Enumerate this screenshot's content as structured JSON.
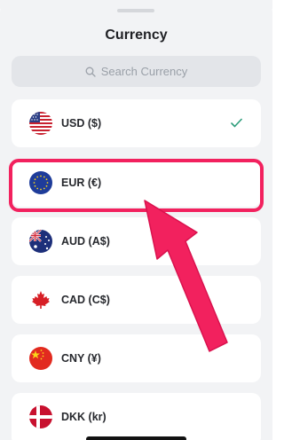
{
  "sheet": {
    "title": "Currency"
  },
  "search": {
    "placeholder": "Search Currency"
  },
  "currencies": [
    {
      "label": "USD ($)",
      "flag": "us-flag-icon",
      "selected": true
    },
    {
      "label": "EUR (€)",
      "flag": "eu-flag-icon",
      "selected": false
    },
    {
      "label": "AUD (A$)",
      "flag": "au-flag-icon",
      "selected": false
    },
    {
      "label": "CAD (C$)",
      "flag": "ca-flag-icon",
      "selected": false
    },
    {
      "label": "CNY (¥)",
      "flag": "cn-flag-icon",
      "selected": false
    },
    {
      "label": "DKK (kr)",
      "flag": "dk-flag-icon",
      "selected": false
    }
  ],
  "colors": {
    "highlight": "#f2215e",
    "check": "#2e9d7b",
    "sheet_bg": "#f2f3f5"
  }
}
